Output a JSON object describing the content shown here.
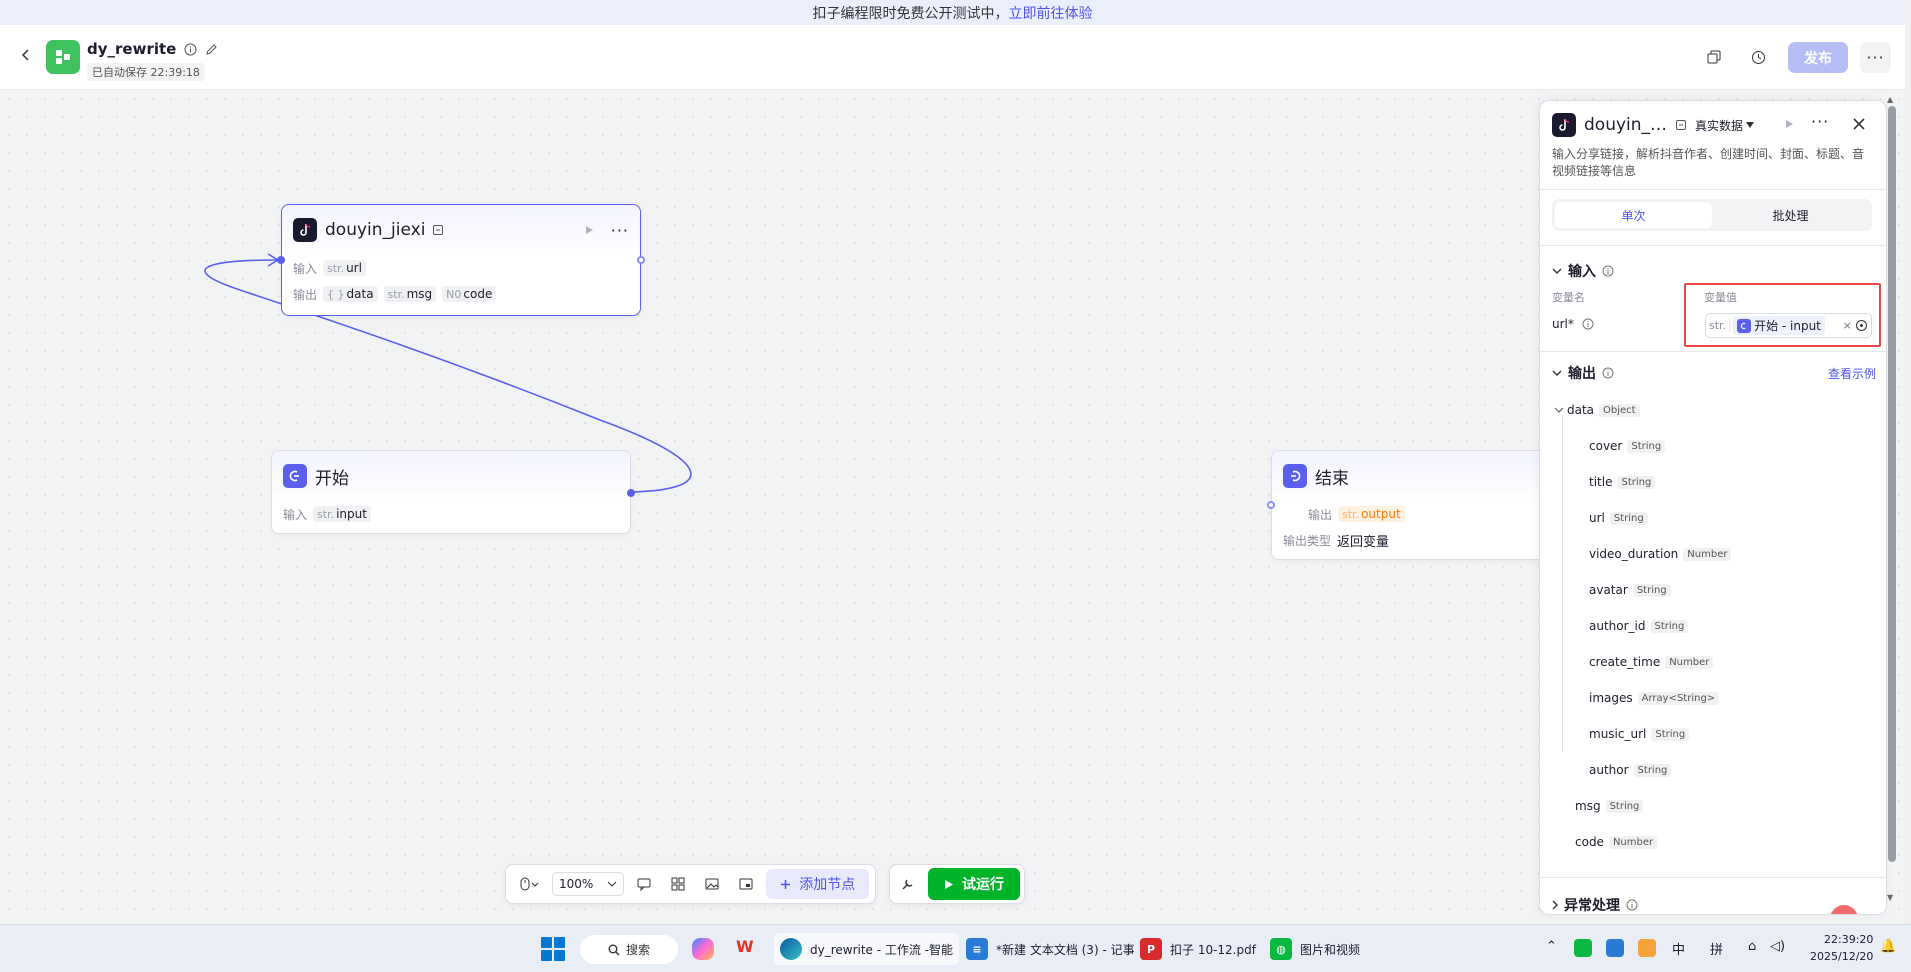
{
  "banner": {
    "text": "扣子编程限时免费公开测试中，",
    "link": "立即前往体验"
  },
  "header": {
    "title": "dy_rewrite",
    "autosave": "已自动保存 22:39:18",
    "publish_label": "发布",
    "more_label": "···"
  },
  "nodes": {
    "douyin": {
      "title": "douyin_jiexi",
      "input_label": "输入",
      "output_label": "输出",
      "input_params": [
        {
          "type": "str.",
          "name": "url"
        }
      ],
      "output_params": [
        {
          "type": "{ }",
          "name": "data"
        },
        {
          "type": "str.",
          "name": "msg"
        },
        {
          "type": "N0",
          "name": "code"
        }
      ]
    },
    "start": {
      "title": "开始",
      "input_label": "输入",
      "input_params": [
        {
          "type": "str.",
          "name": "input"
        }
      ]
    },
    "end": {
      "title": "结束",
      "output_label": "输出",
      "output_param": {
        "type": "str.",
        "name": "output"
      },
      "output_type_label": "输出类型",
      "output_type_value": "返回变量"
    }
  },
  "toolbar": {
    "zoom": "100%",
    "add_node_label": "添加节点",
    "run_label": "试运行"
  },
  "panel": {
    "title": "douyin_…",
    "real_data_label": "真实数据",
    "description": "输入分享链接，解析抖音作者、创建时间、封面、标题、音视频链接等信息",
    "tabs": [
      "单次",
      "批处理"
    ],
    "input_section": "输入",
    "var_name_label": "变量名",
    "var_value_label": "变量值",
    "param_name": "url*",
    "param_type": "str.",
    "param_ref": "开始 - input",
    "output_section": "输出",
    "view_example": "查看示例",
    "output_tree": [
      {
        "name": "data",
        "type": "Object"
      },
      {
        "name": "cover",
        "type": "String"
      },
      {
        "name": "title",
        "type": "String"
      },
      {
        "name": "url",
        "type": "String"
      },
      {
        "name": "video_duration",
        "type": "Number"
      },
      {
        "name": "avatar",
        "type": "String"
      },
      {
        "name": "author_id",
        "type": "String"
      },
      {
        "name": "create_time",
        "type": "Number"
      },
      {
        "name": "images",
        "type": "Array<String>"
      },
      {
        "name": "music_url",
        "type": "String"
      },
      {
        "name": "author",
        "type": "String"
      },
      {
        "name": "msg",
        "type": "String"
      },
      {
        "name": "code",
        "type": "Number"
      }
    ],
    "exception_section": "异常处理"
  },
  "taskbar": {
    "search_label": "搜索",
    "apps": [
      {
        "label": "dy_rewrite - 工作流 -智能"
      },
      {
        "label": "*新建 文本文档 (3) - 记事"
      },
      {
        "label": "扣子 10-12.pdf"
      },
      {
        "label": "图片和视频"
      }
    ],
    "ime_1": "中",
    "ime_2": "拼",
    "time": "22:39:20",
    "date": "2025/12/20"
  },
  "colors": {
    "accent": "#4d53e8",
    "run_green": "#00b42a",
    "highlight_red": "#e84848"
  }
}
